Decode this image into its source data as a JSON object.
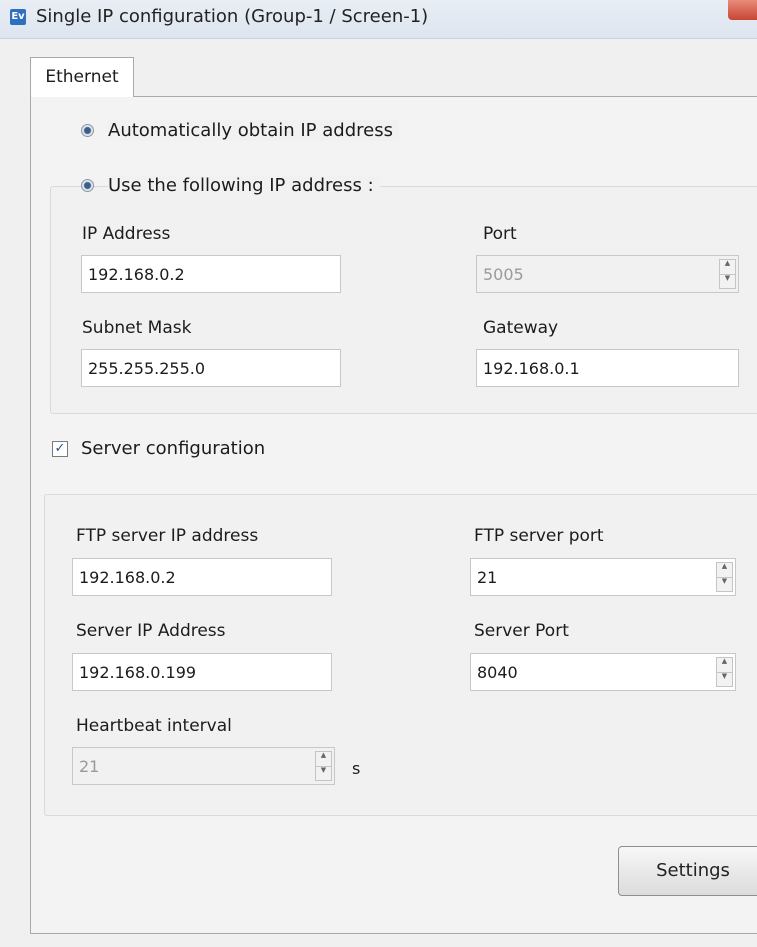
{
  "window": {
    "title": "Single IP configuration   (Group-1 / Screen-1)",
    "app_icon": "app-icon"
  },
  "tabs": {
    "ethernet": "Ethernet"
  },
  "ip_mode": {
    "auto_label": "Automatically obtain IP address",
    "manual_label": "Use the following IP address :"
  },
  "ip": {
    "ip_address_label": "IP Address",
    "ip_address": "192.168.0.2",
    "port_label": "Port",
    "port": "5005",
    "subnet_label": "Subnet Mask",
    "subnet": "255.255.255.0",
    "gateway_label": "Gateway",
    "gateway": "192.168.0.1"
  },
  "server_config": {
    "label": "Server configuration",
    "checked": true
  },
  "server": {
    "ftp_ip_label": "FTP server IP address",
    "ftp_ip": "192.168.0.2",
    "ftp_port_label": "FTP server port",
    "ftp_port": "21",
    "server_ip_label": "Server IP Address",
    "server_ip": "192.168.0.199",
    "server_port_label": "Server Port",
    "server_port": "8040",
    "heartbeat_label": "Heartbeat interval",
    "heartbeat": "21",
    "heartbeat_unit": "s"
  },
  "buttons": {
    "settings": "Settings"
  }
}
